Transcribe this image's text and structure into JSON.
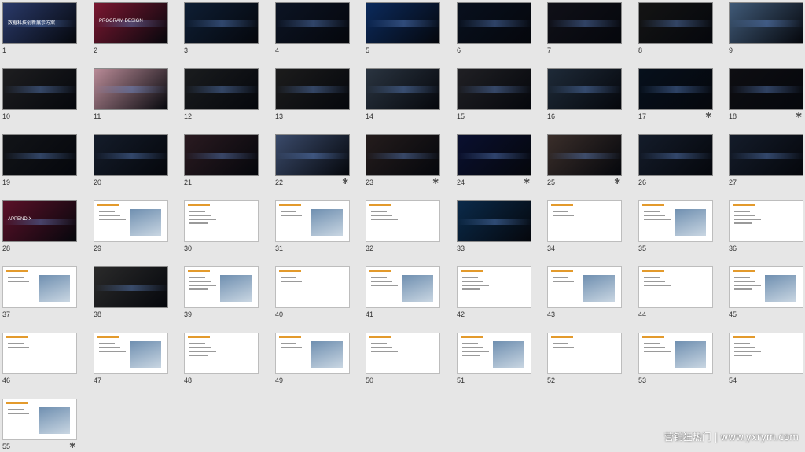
{
  "slides": [
    {
      "num": "1",
      "theme": "dark",
      "bg": "#2a3a6a",
      "title": "数据科技创新展示方案",
      "star": false
    },
    {
      "num": "2",
      "theme": "dark",
      "bg": "#7a1730",
      "title": "PROGRAM DESIGN",
      "star": false
    },
    {
      "num": "3",
      "theme": "dark",
      "bg": "#0e1e34",
      "title": "",
      "star": false
    },
    {
      "num": "4",
      "theme": "dark",
      "bg": "#0c1424",
      "title": "",
      "star": false
    },
    {
      "num": "5",
      "theme": "dark",
      "bg": "#0b2a5c",
      "title": "",
      "star": false
    },
    {
      "num": "6",
      "theme": "dark",
      "bg": "#08101e",
      "title": "",
      "star": false
    },
    {
      "num": "7",
      "theme": "dark",
      "bg": "#101018",
      "title": "",
      "star": false
    },
    {
      "num": "8",
      "theme": "dark",
      "bg": "#141414",
      "title": "",
      "star": false
    },
    {
      "num": "9",
      "theme": "dark",
      "bg": "#405a78",
      "title": "",
      "star": false
    },
    {
      "num": "10",
      "theme": "dark",
      "bg": "#1e1e20",
      "title": "",
      "star": false
    },
    {
      "num": "11",
      "theme": "dark",
      "bg": "#b88a96",
      "title": "",
      "star": false
    },
    {
      "num": "12",
      "theme": "dark",
      "bg": "#1a1c1e",
      "title": "",
      "star": false
    },
    {
      "num": "13",
      "theme": "dark",
      "bg": "#1c1c1c",
      "title": "",
      "star": false
    },
    {
      "num": "14",
      "theme": "dark",
      "bg": "#2a3440",
      "title": "",
      "star": false
    },
    {
      "num": "15",
      "theme": "dark",
      "bg": "#202024",
      "title": "",
      "star": false
    },
    {
      "num": "16",
      "theme": "dark",
      "bg": "#1e2a38",
      "title": "",
      "star": false
    },
    {
      "num": "17",
      "theme": "dark",
      "bg": "#06101c",
      "title": "",
      "star": true
    },
    {
      "num": "18",
      "theme": "dark",
      "bg": "#0e0e12",
      "title": "",
      "star": true
    },
    {
      "num": "19",
      "theme": "dark",
      "bg": "#121418",
      "title": "",
      "star": false
    },
    {
      "num": "20",
      "theme": "dark",
      "bg": "#141c2a",
      "title": "",
      "star": false
    },
    {
      "num": "21",
      "theme": "dark",
      "bg": "#2a1a20",
      "title": "",
      "star": false
    },
    {
      "num": "22",
      "theme": "dark",
      "bg": "#3a4a6a",
      "title": "",
      "star": true
    },
    {
      "num": "23",
      "theme": "dark",
      "bg": "#241c1c",
      "title": "",
      "star": true
    },
    {
      "num": "24",
      "theme": "dark",
      "bg": "#0a1030",
      "title": "",
      "star": true
    },
    {
      "num": "25",
      "theme": "dark",
      "bg": "#3a2e2a",
      "title": "",
      "star": true
    },
    {
      "num": "26",
      "theme": "dark",
      "bg": "#141c2a",
      "title": "",
      "star": false
    },
    {
      "num": "27",
      "theme": "dark",
      "bg": "#141c2a",
      "title": "",
      "star": false
    },
    {
      "num": "28",
      "theme": "dark",
      "bg": "#5a1028",
      "title": "APPENDIX",
      "star": false
    },
    {
      "num": "29",
      "theme": "light",
      "bg": "#ffffff",
      "title": "",
      "star": false
    },
    {
      "num": "30",
      "theme": "light",
      "bg": "#ffffff",
      "title": "",
      "star": false
    },
    {
      "num": "31",
      "theme": "light",
      "bg": "#ffffff",
      "title": "",
      "star": false
    },
    {
      "num": "32",
      "theme": "light",
      "bg": "#ffffff",
      "title": "",
      "star": false
    },
    {
      "num": "33",
      "theme": "dark",
      "bg": "#0a2a4a",
      "title": "",
      "star": false
    },
    {
      "num": "34",
      "theme": "light",
      "bg": "#ffffff",
      "title": "",
      "star": false
    },
    {
      "num": "35",
      "theme": "light",
      "bg": "#ffffff",
      "title": "",
      "star": false
    },
    {
      "num": "36",
      "theme": "light",
      "bg": "#ffffff",
      "title": "",
      "star": false
    },
    {
      "num": "37",
      "theme": "light",
      "bg": "#ffffff",
      "title": "",
      "star": false
    },
    {
      "num": "38",
      "theme": "dark",
      "bg": "#2a2a2a",
      "title": "",
      "star": false
    },
    {
      "num": "39",
      "theme": "light",
      "bg": "#ffffff",
      "title": "",
      "star": false
    },
    {
      "num": "40",
      "theme": "light",
      "bg": "#ffffff",
      "title": "",
      "star": false
    },
    {
      "num": "41",
      "theme": "light",
      "bg": "#ffffff",
      "title": "",
      "star": false
    },
    {
      "num": "42",
      "theme": "light",
      "bg": "#ffffff",
      "title": "",
      "star": false
    },
    {
      "num": "43",
      "theme": "light",
      "bg": "#ffffff",
      "title": "",
      "star": false
    },
    {
      "num": "44",
      "theme": "light",
      "bg": "#ffffff",
      "title": "",
      "star": false
    },
    {
      "num": "45",
      "theme": "light",
      "bg": "#ffffff",
      "title": "",
      "star": false
    },
    {
      "num": "46",
      "theme": "light",
      "bg": "#ffffff",
      "title": "",
      "star": false
    },
    {
      "num": "47",
      "theme": "light",
      "bg": "#ffffff",
      "title": "",
      "star": false
    },
    {
      "num": "48",
      "theme": "light",
      "bg": "#ffffff",
      "title": "",
      "star": false
    },
    {
      "num": "49",
      "theme": "light",
      "bg": "#ffffff",
      "title": "",
      "star": false
    },
    {
      "num": "50",
      "theme": "light",
      "bg": "#ffffff",
      "title": "",
      "star": false
    },
    {
      "num": "51",
      "theme": "light",
      "bg": "#ffffff",
      "title": "",
      "star": false
    },
    {
      "num": "52",
      "theme": "light",
      "bg": "#ffffff",
      "title": "",
      "star": false
    },
    {
      "num": "53",
      "theme": "light",
      "bg": "#ffffff",
      "title": "",
      "star": false
    },
    {
      "num": "54",
      "theme": "light",
      "bg": "#ffffff",
      "title": "",
      "star": false
    },
    {
      "num": "55",
      "theme": "light",
      "bg": "#ffffff",
      "title": "",
      "star": true
    }
  ],
  "watermark": "营销狂热门 | www.yxrym.com",
  "star_glyph": "✱",
  "colors": {
    "accent": "#e39a2c",
    "page_bg": "#e6e6e6"
  }
}
